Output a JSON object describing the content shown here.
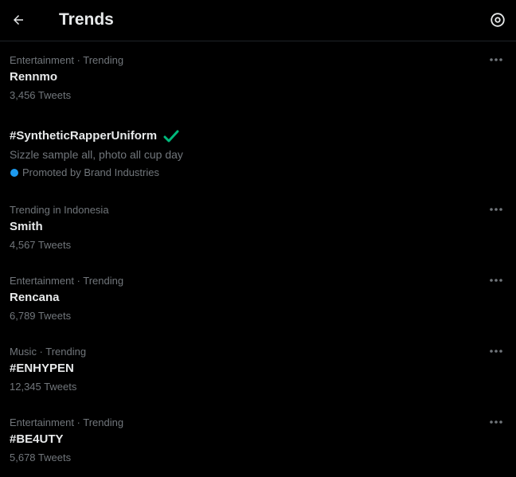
{
  "header": {
    "title": "Trends",
    "back_icon": "arrow-left-icon",
    "settings_icon": "gear-icon"
  },
  "trends": [
    {
      "context": "Entertainment · Trending",
      "name": "Rennmo",
      "count": "3,456 Tweets"
    },
    {
      "context": "Trending in Indonesia",
      "name": "Smith",
      "count": "4,567 Tweets"
    },
    {
      "context": "Entertainment · Trending",
      "name": "Rencana",
      "count": "6,789 Tweets"
    },
    {
      "context": "Music · Trending",
      "name": "#ENHYPEN",
      "count": "12,345 Tweets"
    },
    {
      "context": "Entertainment · Trending",
      "name": "#BE4UTY",
      "count": "5,678 Tweets"
    }
  ],
  "promoted": {
    "hashtag": "#SyntheticRapperUniform",
    "description": "Sizzle sample all, photo all cup day",
    "by": "Promoted by Brand Industries"
  },
  "colors": {
    "background": "#000000",
    "text": "#e7e9ea",
    "muted": "#71767b",
    "verified_green": "#00ba7c",
    "promoted_blue": "#1d9bf0"
  }
}
